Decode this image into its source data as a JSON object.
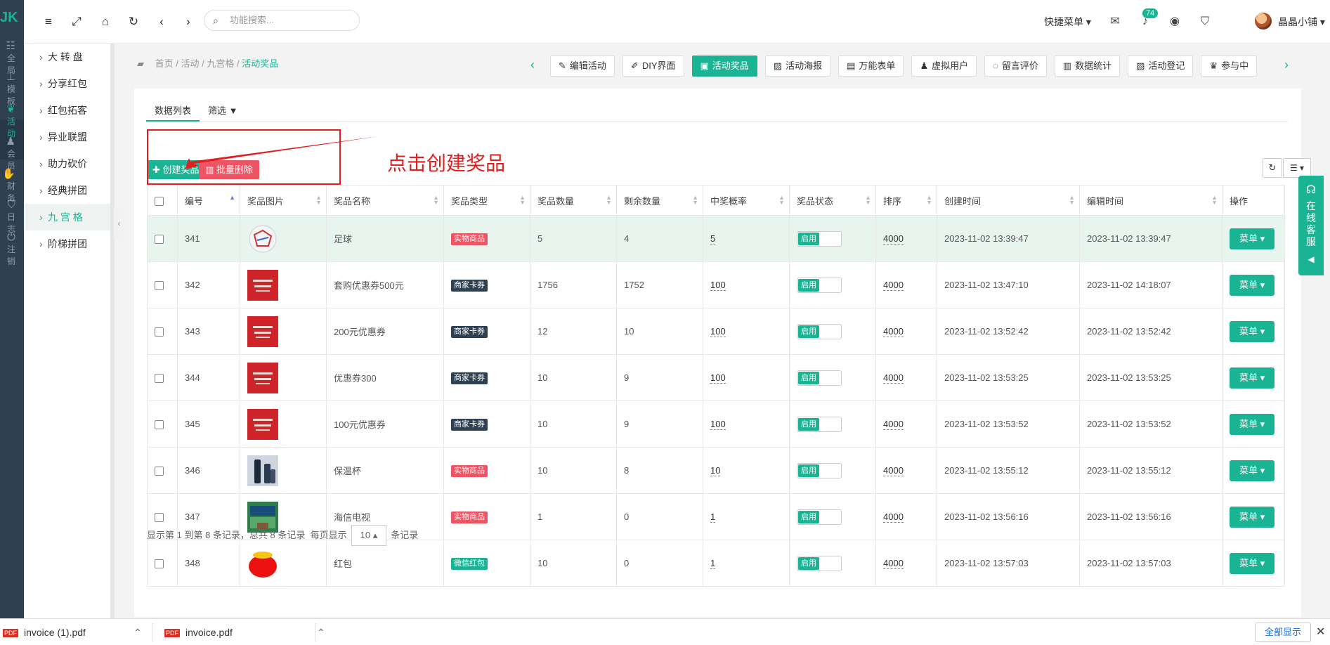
{
  "rail": {
    "logo": "JK",
    "items": [
      {
        "label": "全局",
        "active": false
      },
      {
        "label": "模板",
        "active": false
      },
      {
        "label": "活动",
        "active": true
      },
      {
        "label": "会员",
        "active": false
      },
      {
        "label": "财务",
        "active": false
      },
      {
        "label": "日志",
        "active": false
      },
      {
        "label": "注销",
        "active": false
      }
    ]
  },
  "submenu": {
    "items": [
      {
        "label": "大 转 盘"
      },
      {
        "label": "分享红包"
      },
      {
        "label": "红包拓客"
      },
      {
        "label": "异业联盟"
      },
      {
        "label": "助力砍价"
      },
      {
        "label": "经典拼团"
      },
      {
        "label": "九 宫 格"
      },
      {
        "label": "阶梯拼团"
      }
    ],
    "active_index": 6
  },
  "header": {
    "search_placeholder": "功能搜索...",
    "quick_menu": "快捷菜单",
    "message_count": "74",
    "user_name": "晶晶小铺"
  },
  "breadcrumb": {
    "home": "首页",
    "level1": "活动",
    "level2": "九宫格",
    "current": "活动奖品",
    "sep": " / "
  },
  "page_tabs": [
    {
      "label": "编辑活动",
      "icon": "edit-icon",
      "glyph": "✎",
      "active": false
    },
    {
      "label": "DIY界面",
      "icon": "brush-icon",
      "glyph": "✐",
      "active": false
    },
    {
      "label": "活动奖品",
      "icon": "gift-icon",
      "glyph": "▣",
      "active": true
    },
    {
      "label": "活动海报",
      "icon": "image-icon",
      "glyph": "▨",
      "active": false
    },
    {
      "label": "万能表单",
      "icon": "file-icon",
      "glyph": "▤",
      "active": false
    },
    {
      "label": "虚拟用户",
      "icon": "user-plus-icon",
      "glyph": "♟",
      "active": false
    },
    {
      "label": "留言评价",
      "icon": "comment-icon",
      "glyph": "◌",
      "active": false
    },
    {
      "label": "数据统计",
      "icon": "chart-icon",
      "glyph": "▥",
      "active": false
    },
    {
      "label": "活动登记",
      "icon": "clipboard-icon",
      "glyph": "▧",
      "active": false
    },
    {
      "label": "参与中",
      "icon": "trophy-icon",
      "glyph": "♛",
      "active": false
    }
  ],
  "view_tabs": {
    "list": "数据列表",
    "filter": "筛选"
  },
  "toolbar": {
    "create": "创建奖品",
    "batch_delete": "批量删除"
  },
  "annotation": {
    "text": "点击创建奖品"
  },
  "table": {
    "columns": [
      "编号",
      "奖品图片",
      "奖品名称",
      "奖品类型",
      "奖品数量",
      "剩余数量",
      "中奖概率",
      "奖品状态",
      "排序",
      "创建时间",
      "编辑时间",
      "操作"
    ],
    "toggle_label": "启用",
    "menu_label": "菜单",
    "rows": [
      {
        "id": "341",
        "image": "football",
        "name": "足球",
        "type": "实物商品",
        "type_color": "red",
        "qty": "5",
        "remain": "4",
        "prob": "5",
        "sort": "4000",
        "created": "2023-11-02 13:39:47",
        "edited": "2023-11-02 13:39:47",
        "highlight": true
      },
      {
        "id": "342",
        "image": "coupon",
        "name": "套购优惠券500元",
        "type": "商家卡券",
        "type_color": "dark",
        "qty": "1756",
        "remain": "1752",
        "prob": "100",
        "sort": "4000",
        "created": "2023-11-02 13:47:10",
        "edited": "2023-11-02 14:18:07",
        "highlight": false
      },
      {
        "id": "343",
        "image": "coupon",
        "name": "200元优惠券",
        "type": "商家卡券",
        "type_color": "dark",
        "qty": "12",
        "remain": "10",
        "prob": "100",
        "sort": "4000",
        "created": "2023-11-02 13:52:42",
        "edited": "2023-11-02 13:52:42",
        "highlight": false
      },
      {
        "id": "344",
        "image": "coupon",
        "name": "优惠券300",
        "type": "商家卡券",
        "type_color": "dark",
        "qty": "10",
        "remain": "9",
        "prob": "100",
        "sort": "4000",
        "created": "2023-11-02 13:53:25",
        "edited": "2023-11-02 13:53:25",
        "highlight": false
      },
      {
        "id": "345",
        "image": "coupon",
        "name": "100元优惠券",
        "type": "商家卡券",
        "type_color": "dark",
        "qty": "10",
        "remain": "9",
        "prob": "100",
        "sort": "4000",
        "created": "2023-11-02 13:53:52",
        "edited": "2023-11-02 13:53:52",
        "highlight": false
      },
      {
        "id": "346",
        "image": "thermos",
        "name": "保温杯",
        "type": "实物商品",
        "type_color": "red",
        "qty": "10",
        "remain": "8",
        "prob": "10",
        "sort": "4000",
        "created": "2023-11-02 13:55:12",
        "edited": "2023-11-02 13:55:12",
        "highlight": false
      },
      {
        "id": "347",
        "image": "tv",
        "name": "海信电视",
        "type": "实物商品",
        "type_color": "red",
        "qty": "1",
        "remain": "0",
        "prob": "1",
        "sort": "4000",
        "created": "2023-11-02 13:56:16",
        "edited": "2023-11-02 13:56:16",
        "highlight": false
      },
      {
        "id": "348",
        "image": "redpacket",
        "name": "红包",
        "type": "微信红包",
        "type_color": "green",
        "qty": "10",
        "remain": "0",
        "prob": "1",
        "sort": "4000",
        "created": "2023-11-02 13:57:03",
        "edited": "2023-11-02 13:57:03",
        "highlight": false
      }
    ]
  },
  "pagination": {
    "summary": "显示第 1 到第 8 条记录，总共 8 条记录",
    "per_page_label": "每页显示",
    "per_page": "10",
    "suffix": "条记录"
  },
  "service": {
    "label": "在线客服"
  },
  "downloads": {
    "files": [
      "invoice (1).pdf",
      "invoice.pdf"
    ],
    "show_all": "全部显示"
  },
  "colors": {
    "primary": "#1ab394",
    "danger": "#ed5565",
    "rail": "#2f4050",
    "annotation": "#e02020"
  }
}
